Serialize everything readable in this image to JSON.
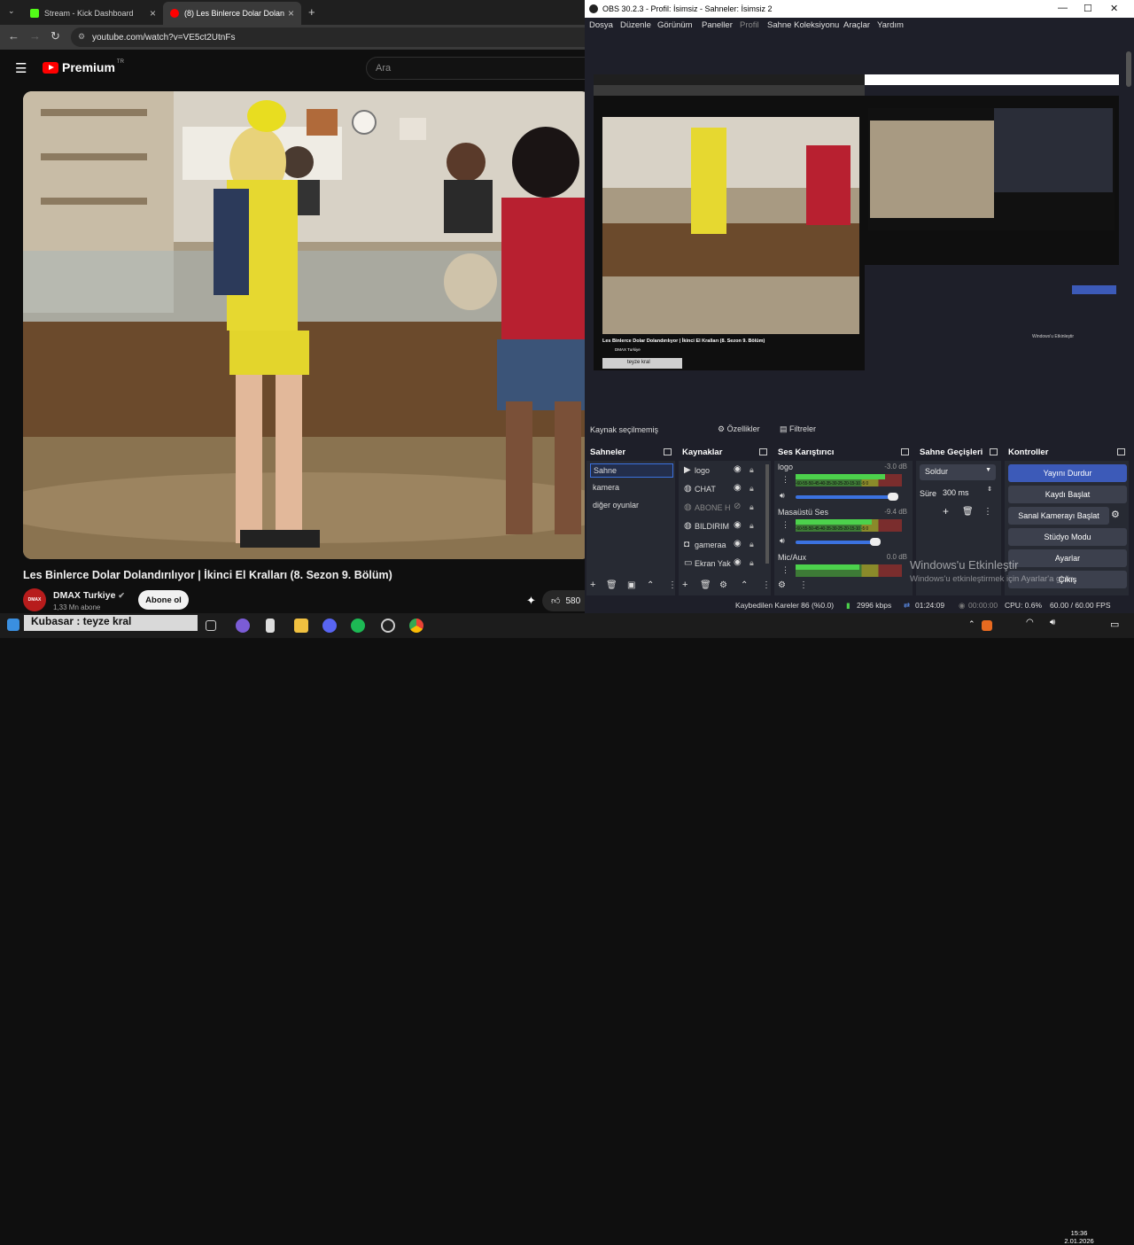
{
  "browser": {
    "tabs": [
      {
        "label": "Stream - Kick Dashboard",
        "active": false
      },
      {
        "label": "(8) Les Binlerce Dolar Dolan",
        "active": true
      }
    ],
    "url": "youtube.com/watch?v=VE5ct2UtnFs",
    "new_tab_icon": "plus-icon"
  },
  "youtube": {
    "logo_text": "Premium",
    "logo_region": "TR",
    "search_placeholder": "Ara",
    "video_title": "Les Binlerce Dolar Dolandırılıyor | İkinci El Kralları (8. Sezon 9. Bölüm)",
    "channel_name": "DMAX Turkiye",
    "channel_avatar_text": "DMAX",
    "subscribers": "1,33 Mn abone",
    "subscribe_label": "Abone ol",
    "like_count": "580"
  },
  "obs": {
    "title": "OBS 30.2.3 - Profil: İsimsiz - Sahneler: İsimsiz 2",
    "menu": [
      "Dosya",
      "Düzenle",
      "Görünüm",
      "Paneller",
      "Profil",
      "Sahne Koleksiyonu",
      "Araçlar",
      "Yardım"
    ],
    "preview_mini": {
      "title": "Les Binlerce Dolar Dolandırılıyor | İkinci El Kralları (8. Sezon 9. Bölüm)",
      "channel": "DMAX Turkiye",
      "chat": "teyze kral",
      "watermark": "Windows'u Etkinleştir"
    },
    "source_status": "Kaynak seçilmemiş",
    "properties_label": "Özellikler",
    "filters_label": "Filtreler",
    "docks": {
      "scenes": {
        "title": "Sahneler",
        "items": [
          "Sahne",
          "kamera",
          "diğer oyunlar"
        ],
        "selected": "Sahne"
      },
      "sources": {
        "title": "Kaynaklar",
        "items": [
          {
            "name": "logo",
            "icon": "play-icon"
          },
          {
            "name": "CHAT",
            "icon": "globe-icon"
          },
          {
            "name": "ABONE H",
            "icon": "globe-icon",
            "hidden": true
          },
          {
            "name": "BILDIRIM",
            "icon": "globe-icon"
          },
          {
            "name": "gameraa",
            "icon": "camera-icon"
          },
          {
            "name": "Ekran Yak",
            "icon": "monitor-icon"
          }
        ]
      },
      "mixer": {
        "title": "Ses Karıştırıcı",
        "scale": "-60-55-50-45-40-35-30-25-20-15-10 -5 0",
        "channels": [
          {
            "name": "logo",
            "db": "-3.0 dB",
            "level": 0.84
          },
          {
            "name": "Masaüstü Ses",
            "db": "-9.4 dB",
            "level": 0.72
          },
          {
            "name": "Mic/Aux",
            "db": "0.0 dB",
            "level": 0.6
          }
        ]
      },
      "transitions": {
        "title": "Sahne Geçişleri",
        "type": "Soldur",
        "duration_label": "Süre",
        "duration": "300 ms"
      },
      "controls": {
        "title": "Kontroller",
        "buttons": [
          "Yayını Durdur",
          "Kaydı Başlat",
          "Sanal Kamerayı Başlat",
          "Stüdyo Modu",
          "Ayarlar",
          "Çıkış"
        ]
      }
    },
    "status": {
      "dropped": "Kaybedilen Kareler 86 (%0.0)",
      "bitrate": "2996 kbps",
      "live_time": "01:24:09",
      "rec_time": "00:00:00",
      "cpu": "CPU: 0.6%",
      "fps": "60.00 / 60.00 FPS"
    },
    "watermark_title": "Windows'u Etkinleştir",
    "watermark_sub": "Windows'u etkinleştirmek için Ayarlar'a gidin."
  },
  "taskbar": {
    "chat_overlay": "Kubasar : teyze kral",
    "time": "15:36",
    "date": "2.01.2026"
  },
  "colors": {
    "accent": "#3c5ab8",
    "yt_red": "#ff0000",
    "obs_bg": "#1e1f29"
  }
}
